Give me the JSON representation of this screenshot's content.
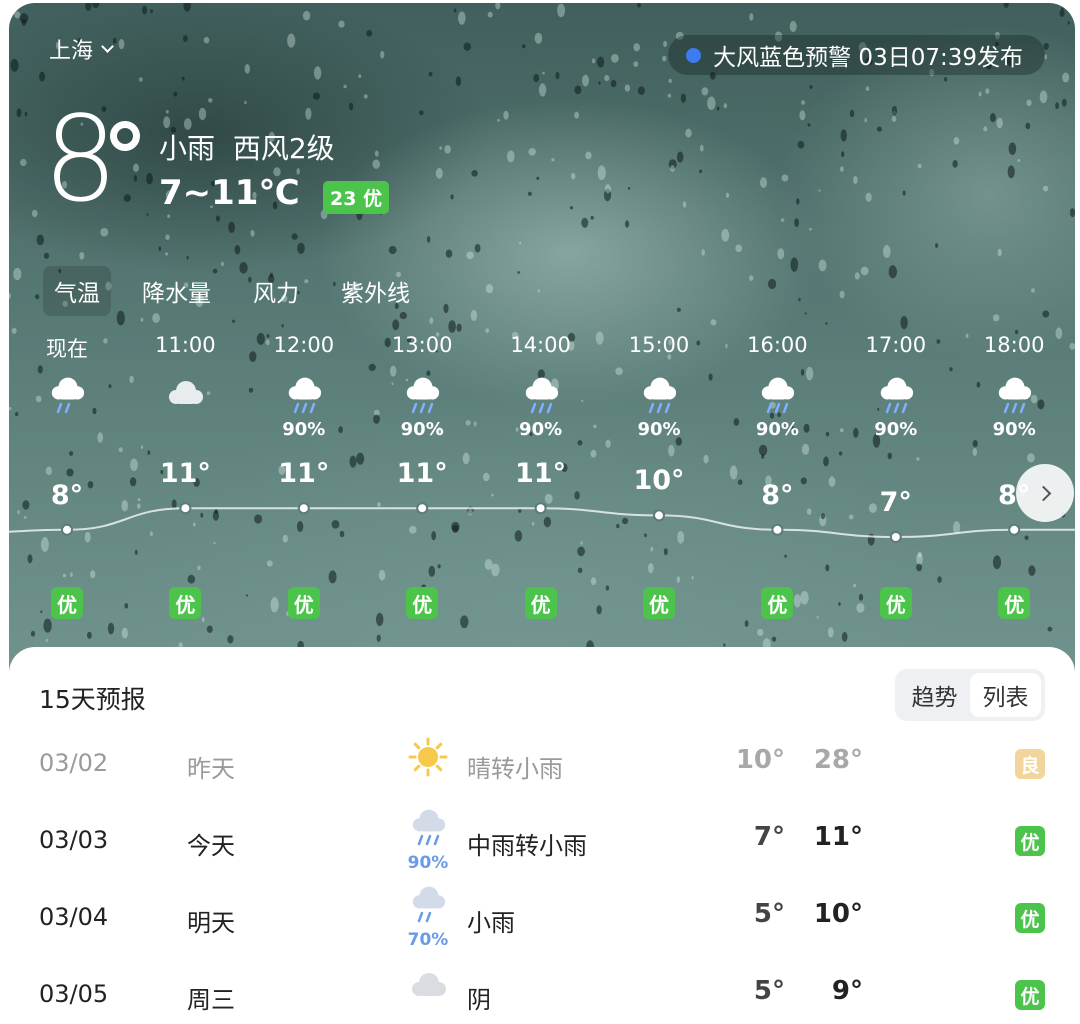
{
  "colors": {
    "accent_green": "#4cc44c",
    "alert_blue": "#3d7bf0",
    "aqi_good_faded": "#f1d59a",
    "rain_blue": "#6a9ae8"
  },
  "location": {
    "city": "上海"
  },
  "alert": {
    "text": "大风蓝色预警 03日07:39发布"
  },
  "current": {
    "temp": "8",
    "condition": "小雨",
    "wind": "西风2级",
    "range": "7~11℃",
    "aqi": "23 优"
  },
  "tabs": [
    "气温",
    "降水量",
    "风力",
    "紫外线"
  ],
  "hourly": [
    {
      "time": "现在",
      "icon": "light-rain-icon",
      "precip": "",
      "temp": "8°",
      "temp_value": 8,
      "aqi": "优"
    },
    {
      "time": "11:00",
      "icon": "cloudy-icon",
      "precip": "",
      "temp": "11°",
      "temp_value": 11,
      "aqi": "优"
    },
    {
      "time": "12:00",
      "icon": "rain-icon",
      "precip": "90%",
      "temp": "11°",
      "temp_value": 11,
      "aqi": "优"
    },
    {
      "time": "13:00",
      "icon": "rain-icon",
      "precip": "90%",
      "temp": "11°",
      "temp_value": 11,
      "aqi": "优"
    },
    {
      "time": "14:00",
      "icon": "rain-icon",
      "precip": "90%",
      "temp": "11°",
      "temp_value": 11,
      "aqi": "优"
    },
    {
      "time": "15:00",
      "icon": "rain-icon",
      "precip": "90%",
      "temp": "10°",
      "temp_value": 10,
      "aqi": "优"
    },
    {
      "time": "16:00",
      "icon": "rain-icon",
      "precip": "90%",
      "temp": "8°",
      "temp_value": 8,
      "aqi": "优"
    },
    {
      "time": "17:00",
      "icon": "rain-icon",
      "precip": "90%",
      "temp": "7°",
      "temp_value": 7,
      "aqi": "优"
    },
    {
      "time": "18:00",
      "icon": "rain-icon",
      "precip": "90%",
      "temp": "8°",
      "temp_value": 8,
      "aqi": "优"
    }
  ],
  "forecast": {
    "title": "15天预报",
    "toggle": [
      "趋势",
      "列表"
    ],
    "days": [
      {
        "date": "03/02",
        "day": "昨天",
        "icon": "sunny-icon",
        "precip": "",
        "desc": "晴转小雨",
        "low": "10°",
        "high": "28°",
        "aqi": "良"
      },
      {
        "date": "03/03",
        "day": "今天",
        "icon": "rain-icon",
        "precip": "90%",
        "desc": "中雨转小雨",
        "low": "7°",
        "high": "11°",
        "aqi": "优"
      },
      {
        "date": "03/04",
        "day": "明天",
        "icon": "light-rain-icon",
        "precip": "70%",
        "desc": "小雨",
        "low": "5°",
        "high": "10°",
        "aqi": "优"
      },
      {
        "date": "03/05",
        "day": "周三",
        "icon": "overcast-icon",
        "precip": "",
        "desc": "阴",
        "low": "5°",
        "high": "9°",
        "aqi": "优"
      }
    ]
  }
}
